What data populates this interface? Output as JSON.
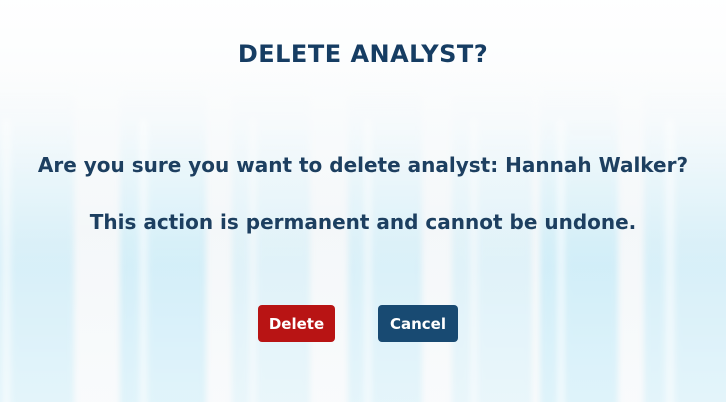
{
  "dialog": {
    "title": "DELETE ANALYST?",
    "confirm_message": "Are you sure you want to delete analyst: Hannah Walker?",
    "warning_message": "This action is permanent and cannot be undone."
  },
  "buttons": {
    "delete_label": "Delete",
    "cancel_label": "Cancel"
  },
  "colors": {
    "title_text": "#163d63",
    "delete_button": "#b81414",
    "cancel_button": "#184a72"
  }
}
